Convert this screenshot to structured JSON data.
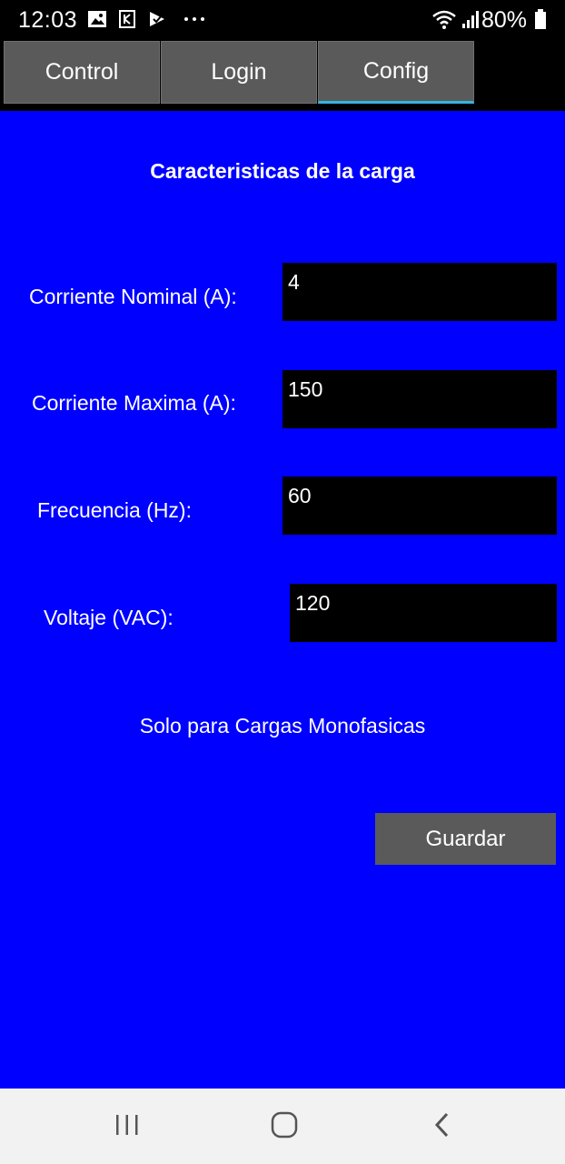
{
  "status_bar": {
    "time": "12:03",
    "battery": "80%",
    "icons": [
      "image-icon",
      "k-app-icon",
      "play-check-icon",
      "more-dots-icon",
      "wifi-icon",
      "signal-icon",
      "battery-icon"
    ]
  },
  "tabs": [
    {
      "label": "Control",
      "active": false
    },
    {
      "label": "Login",
      "active": false
    },
    {
      "label": "Config",
      "active": true
    }
  ],
  "main": {
    "title": "Caracteristicas de la carga",
    "fields": [
      {
        "label": "Corriente Nominal (A):",
        "value": "4"
      },
      {
        "label": "Corriente Maxima (A):",
        "value": "150"
      },
      {
        "label": "Frecuencia (Hz):",
        "value": "60"
      },
      {
        "label": "Voltaje (VAC):",
        "value": "120"
      }
    ],
    "note": "Solo para Cargas Monofasicas",
    "save_label": "Guardar"
  },
  "colors": {
    "background": "#0000ff",
    "tab": "#5a5a5a",
    "tab_active_indicator": "#33b5e5",
    "field_bg": "#000000",
    "button": "#5a5a5a"
  },
  "nav_bar": {
    "icons": [
      "recent-apps-icon",
      "home-icon",
      "back-icon"
    ]
  }
}
